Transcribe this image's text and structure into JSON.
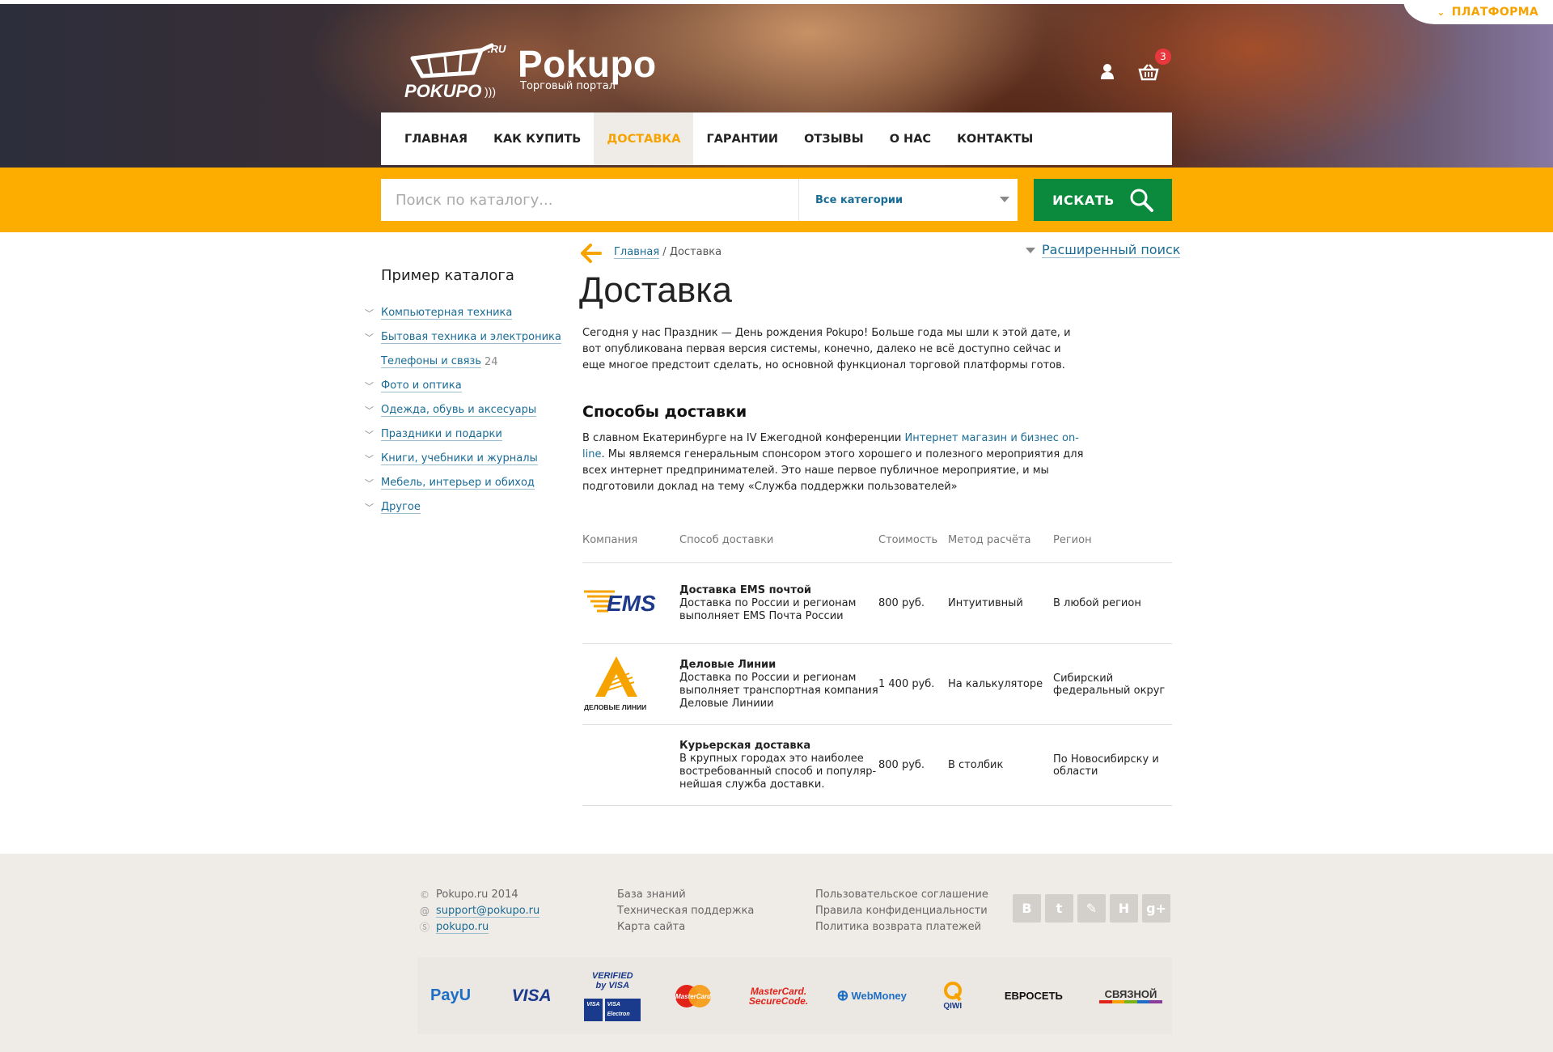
{
  "header": {
    "platform_label": "ПЛАТФОРМА",
    "logo_text": "Pokupo",
    "logo_sub": "Торговый портал",
    "logo_mark": "POKUPO",
    "logo_ru": ".RU",
    "cart_count": "3"
  },
  "nav": {
    "items": [
      {
        "label": "ГЛАВНАЯ"
      },
      {
        "label": "КАК КУПИТЬ"
      },
      {
        "label": "ДОСТАВКА"
      },
      {
        "label": "ГАРАНТИИ"
      },
      {
        "label": "ОТЗЫВЫ"
      },
      {
        "label": "О НАС"
      },
      {
        "label": "КОНТАКТЫ"
      }
    ]
  },
  "search": {
    "placeholder": "Поиск по каталогу...",
    "category": "Все категории",
    "button": "ИСКАТЬ"
  },
  "sidebar": {
    "title": "Пример каталога",
    "items": [
      {
        "label": "Компьютерная техника"
      },
      {
        "label": "Бытовая техника и электроника"
      },
      {
        "label": "Телефоны и связь",
        "count": "24"
      },
      {
        "label": "Фото и оптика"
      },
      {
        "label": "Одежда, обувь и аксесуары"
      },
      {
        "label": "Праздники и подарки"
      },
      {
        "label": "Книги, учебники и журналы"
      },
      {
        "label": "Мебель, интерьер и обиход"
      },
      {
        "label": "Другое"
      }
    ]
  },
  "main": {
    "breadcrumb_home": "Главная",
    "breadcrumb_sep": " / ",
    "breadcrumb_current": "Доставка",
    "advanced_search": "Расширенный поиск",
    "title": "Доставка",
    "intro": "Сегодня у нас Праздник — День рождения Pokupo! Больше года мы шли к этой дате, и вот опубликована первая версия системы, конечно, далеко не всё доступно сейчас и еще многое предстоит сделать, но основной функционал торговой платформы готов.",
    "section_title": "Способы доставки",
    "para_start": "В славном Екатеринбурге на IV Ежегодной конференции ",
    "para_link": "Интернет магазин и бизнес on-line",
    "para_end": ". Мы являемся генеральным спонсором этого хорошего и полезного мероприятия для всех интернет предпринимателей. Это наше первое публичное мероприятие, и мы подготовили доклад на тему «Служба поддержки пользователей»"
  },
  "table": {
    "headers": [
      "Компания",
      "Способ доставки",
      "Стоимость",
      "Метод расчёта",
      "Регион"
    ],
    "rows": [
      {
        "logo": "EMS",
        "name": "Доставка EMS почтой",
        "desc": "Доставка по России и регионам выполняет EMS Почта России",
        "price": "800 руб.",
        "method": "Интуитивный",
        "region": "В любой регион"
      },
      {
        "logo": "ДЕЛОВЫЕ ЛИНИИ",
        "name": "Деловые Линии",
        "desc": "Доставка по России и регионам выполняет транспортная компания Деловые Линиии",
        "price": "1 400 руб.",
        "method": "На калькуляторе",
        "region": "Сибирский федеральный округ"
      },
      {
        "logo": "",
        "name": "Курьерская доставка",
        "desc": "В крупных городах это наиболее востребованный способ и популяр-нейшая  служба доставки.",
        "price": "800 руб.",
        "method": "В столбик",
        "region": "По Новосибирску и области"
      }
    ]
  },
  "footer": {
    "copyright": "Pokupo.ru 2014",
    "email": "support@pokupo.ru",
    "skype": "pokupo.ru",
    "col2": [
      "База знаний",
      "Техническая поддержка",
      "Карта сайта"
    ],
    "col3": [
      "Пользовательское соглашение",
      "Правила конфиденциальности",
      "Политика возврата платежей"
    ],
    "socials": [
      "В",
      "t",
      "✎",
      "Н",
      "g+"
    ],
    "payments": [
      "PayU",
      "VISA",
      "Verified by VISA",
      "MasterCard",
      "MasterCard. SecureCode.",
      "WebMoney",
      "QIWI",
      "ЕВРОСЕТЬ",
      "СВЯЗНОЙ"
    ],
    "vbv_line1": "VERIFIED",
    "vbv_line2": "by VISA",
    "vbv_chip1": "VISA",
    "vbv_chip2": "VISA Electron",
    "mc_line1": "MasterCard.",
    "mc_line2": "SecureCode."
  },
  "colors": {
    "accent": "#fdad00",
    "nav_active": "#f6a300",
    "search_button": "#0b8a3e",
    "link": "#1a6c95",
    "footer_bg": "#efebe7"
  }
}
